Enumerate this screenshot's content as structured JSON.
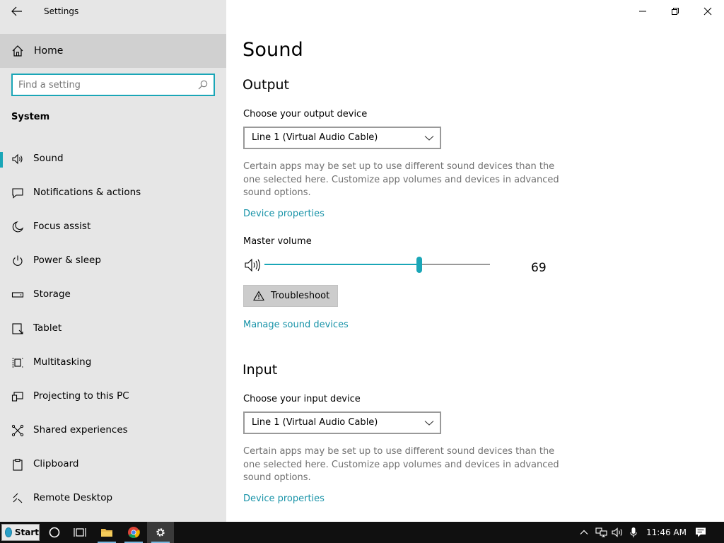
{
  "window": {
    "title": "Settings",
    "minimize_icon": "minimize-icon",
    "restore_icon": "restore-icon",
    "close_icon": "close-icon"
  },
  "sidebar": {
    "home_label": "Home",
    "search_placeholder": "Find a setting",
    "section_title": "System",
    "items": [
      {
        "label": "Sound",
        "icon": "speaker-icon",
        "active": true
      },
      {
        "label": "Notifications & actions",
        "icon": "notification-icon"
      },
      {
        "label": "Focus assist",
        "icon": "moon-icon"
      },
      {
        "label": "Power & sleep",
        "icon": "power-icon"
      },
      {
        "label": "Storage",
        "icon": "storage-icon"
      },
      {
        "label": "Tablet",
        "icon": "tablet-icon"
      },
      {
        "label": "Multitasking",
        "icon": "multitasking-icon"
      },
      {
        "label": "Projecting to this PC",
        "icon": "projecting-icon"
      },
      {
        "label": "Shared experiences",
        "icon": "shared-icon"
      },
      {
        "label": "Clipboard",
        "icon": "clipboard-icon"
      },
      {
        "label": "Remote Desktop",
        "icon": "remote-desktop-icon"
      }
    ]
  },
  "main": {
    "page_title": "Sound",
    "output": {
      "heading": "Output",
      "device_label": "Choose your output device",
      "device_value": "Line 1 (Virtual Audio Cable)",
      "description": "Certain apps may be set up to use different sound devices than the one selected here. Customize app volumes and devices in advanced sound options.",
      "device_properties_link": "Device properties",
      "master_volume_label": "Master volume",
      "volume_value": "69",
      "troubleshoot_label": "Troubleshoot",
      "manage_devices_link": "Manage sound devices"
    },
    "input": {
      "heading": "Input",
      "device_label": "Choose your input device",
      "device_value": "Line 1 (Virtual Audio Cable)",
      "description": "Certain apps may be set up to use different sound devices than the one selected here. Customize app volumes and devices in advanced sound options.",
      "device_properties_link": "Device properties"
    }
  },
  "taskbar": {
    "start_label": "Start",
    "clock": "11:46 AM"
  },
  "colors": {
    "accent": "#1aa6b7",
    "link": "#1893a8",
    "sidebar_bg": "#e6e6e6",
    "taskbar_bg": "#101010"
  }
}
